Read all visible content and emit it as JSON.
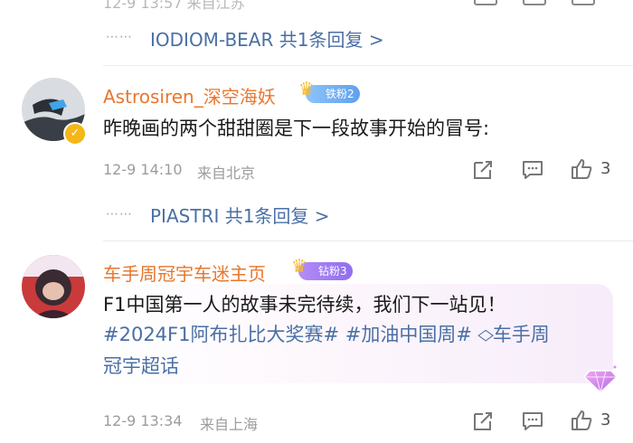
{
  "top_row": {
    "reply_prefix": "⋯⋯",
    "reply_link": "IODIOM-BEAR 共1条回复 >"
  },
  "comments": [
    {
      "username": "Astrosiren_深空海妖",
      "badge": "铁粉2",
      "text": "昨晚画的两个甜甜圈是下一段故事开始的冒号:",
      "date": "12-9 14:10",
      "location": "来自北京",
      "likes": "3",
      "reply_prefix": "⋯⋯",
      "reply_link": "PIASTRI 共1条回复 >"
    },
    {
      "username": "车手周冠宇车迷主页",
      "badge": "钻粉3",
      "text_line1": "F1中国第一人的故事未完待续，我们下一站见！",
      "topic1": "#2024F1阿布扎比大奖赛#",
      "topic2": "#加油中国周#",
      "topic3": "车手周",
      "topic3_line2": "冠宇超话",
      "date": "12-9 13:34",
      "location": "来自上海",
      "likes": "3"
    }
  ],
  "icons": {
    "share": "share-icon",
    "comment": "comment-icon",
    "like": "thumb-up-icon",
    "verified": "verified-icon",
    "diamond": "diamond-icon"
  },
  "colors": {
    "username": "#e8772e",
    "link": "#4a6fa5",
    "meta": "#9c9c9c"
  }
}
